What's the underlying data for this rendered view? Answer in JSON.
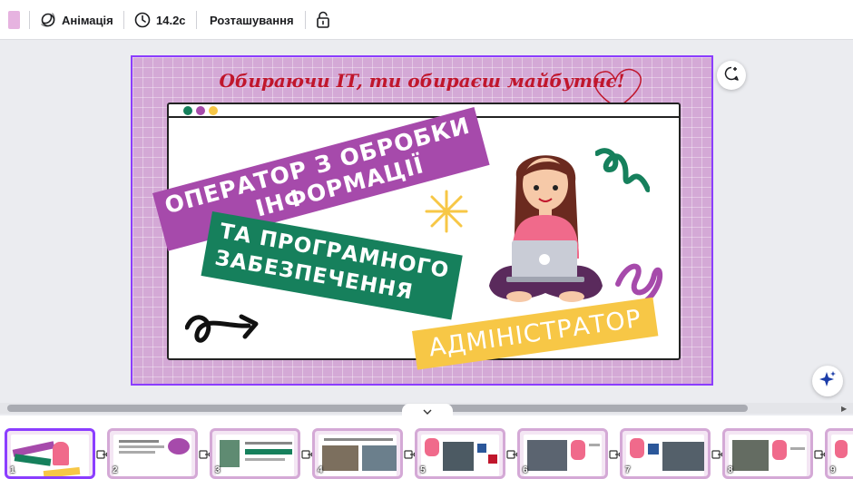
{
  "toolbar": {
    "swatch_color": "#e6b3e0",
    "animation_label": "Анімація",
    "duration_label": "14.2с",
    "position_label": "Розташування",
    "icons": [
      "animation-icon",
      "clock-icon",
      "lock-icon"
    ]
  },
  "slide": {
    "headline": "Обираючи IT, ти обираєш майбутнє!",
    "tag1_line1": "ОПЕРАТОР З ОБРОБКИ",
    "tag1_line2": "ІНФОРМАЦІЇ",
    "tag2_line1": "ТА ПРОГРАМНОГО",
    "tag2_line2": "ЗАБЕЗПЕЧЕННЯ",
    "tag3": "АДМІНІСТРАТОР",
    "colors": {
      "background": "#d4a9d6",
      "purple": "#a64aab",
      "green": "#16805c",
      "yellow": "#f7c746",
      "headline": "#c0162c"
    }
  },
  "filmstrip": {
    "pages": [
      {
        "num": "1",
        "active": true
      },
      {
        "num": "2"
      },
      {
        "num": "3"
      },
      {
        "num": "4"
      },
      {
        "num": "5"
      },
      {
        "num": "6"
      },
      {
        "num": "7"
      },
      {
        "num": "8"
      },
      {
        "num": "9"
      }
    ]
  }
}
